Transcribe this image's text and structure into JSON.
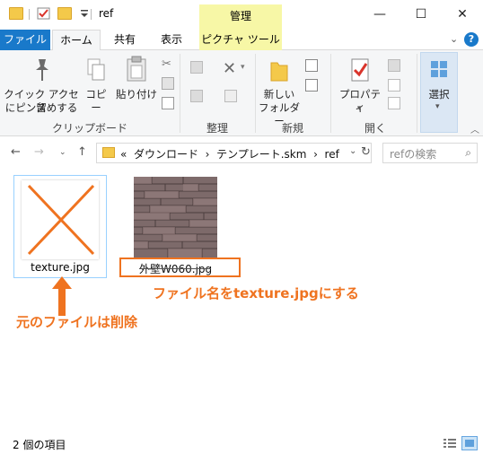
{
  "window": {
    "title": "ref",
    "tool_tab": "管理",
    "minimize": "—",
    "maximize": "☐",
    "close": "✕"
  },
  "tabs": {
    "file": "ファイル",
    "home": "ホーム",
    "share": "共有",
    "view": "表示",
    "picture_tools": "ピクチャ ツール",
    "help": "?"
  },
  "ribbon": {
    "pin_label_1": "クイック アクセス",
    "pin_label_2": "にピン留めする",
    "copy": "コピー",
    "paste": "貼り付け",
    "clipboard_group": "クリップボード",
    "organize_group": "整理",
    "new_folder_1": "新しい",
    "new_folder_2": "フォルダー",
    "new_group": "新規",
    "properties": "プロパティ",
    "open_group": "開く",
    "select": "選択"
  },
  "address": {
    "path_prefix": "«",
    "segments": [
      "ダウンロード",
      "テンプレート.skm",
      "ref"
    ],
    "separator": "›",
    "search_placeholder": "refの検索"
  },
  "files": [
    {
      "name": "texture.jpg"
    },
    {
      "name": "外壁W060.jpg"
    }
  ],
  "annotations": {
    "rename": "ファイル名をtexture.jpgにする",
    "delete": "元のファイルは削除"
  },
  "status": {
    "item_count": "2 個の項目"
  },
  "colors": {
    "accent_blue": "#1979ca",
    "annotation_orange": "#ef7320",
    "tool_tab_yellow": "#f7f7a6"
  }
}
